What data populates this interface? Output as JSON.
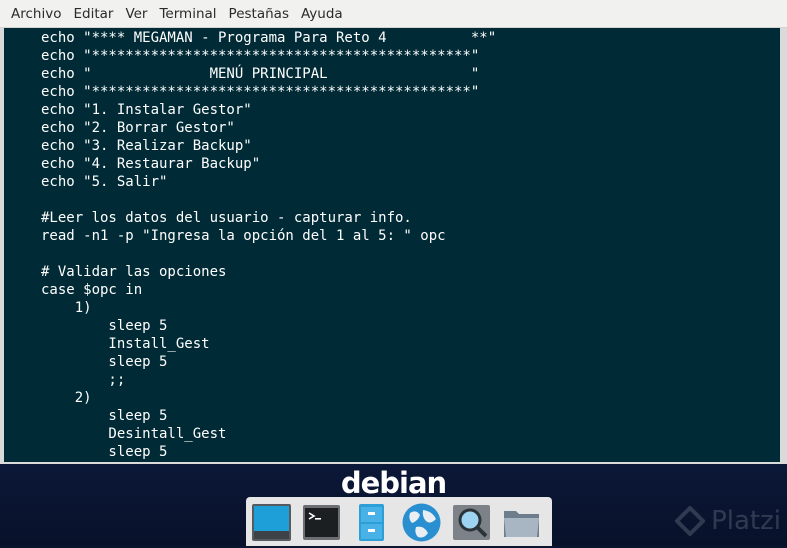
{
  "menubar": {
    "items": [
      "Archivo",
      "Editar",
      "Ver",
      "Terminal",
      "Pestañas",
      "Ayuda"
    ]
  },
  "terminal": {
    "background": "#002b36",
    "lines": [
      "echo \"**** MEGAMAN - Programa Para Reto 4          **\"",
      "echo \"*********************************************\"",
      "echo \"              MENÚ PRINCIPAL                 \"",
      "echo \"*********************************************\"",
      "echo \"1. Instalar Gestor\"",
      "echo \"2. Borrar Gestor\"",
      "echo \"3. Realizar Backup\"",
      "echo \"4. Restaurar Backup\"",
      "echo \"5. Salir\"",
      "",
      "#Leer los datos del usuario - capturar info.",
      "read -n1 -p \"Ingresa la opción del 1 al 5: \" opc",
      "",
      "# Validar las opciones",
      "case $opc in",
      "    1)",
      "        sleep 5",
      "        Install_Gest",
      "        sleep 5",
      "        ;;",
      "    2)",
      "        sleep 5",
      "        Desintall_Gest",
      "        sleep 5"
    ]
  },
  "desktop": {
    "brand": "debian",
    "watermark": "Platzi",
    "dock_icons": [
      "show-desktop-icon",
      "terminal-icon",
      "file-cabinet-icon",
      "web-browser-icon",
      "search-icon",
      "folder-icon"
    ]
  }
}
